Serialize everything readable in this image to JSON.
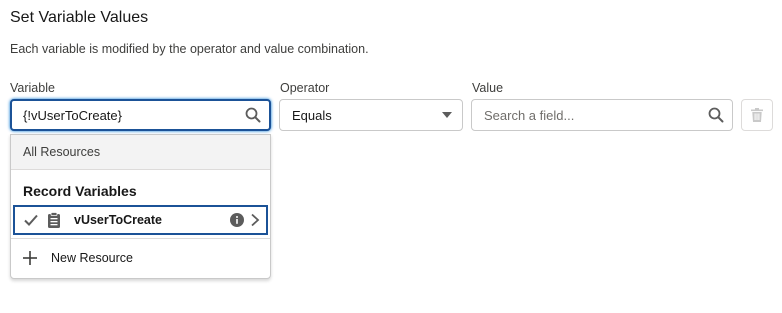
{
  "panel": {
    "title": "Set Variable Values",
    "description": "Each variable is modified by the operator and value combination."
  },
  "fields": {
    "variable_label": "Variable",
    "variable_value": "{!vUserToCreate}",
    "operator_label": "Operator",
    "operator_value": "Equals",
    "value_label": "Value",
    "value_placeholder": "Search a field..."
  },
  "dropdown": {
    "all_resources": "All Resources",
    "group_label": "Record Variables",
    "selected_item": "vUserToCreate",
    "new_resource": "New Resource"
  },
  "icons": {
    "search": "search-icon",
    "caret": "chevron-down-icon",
    "delete": "trash-icon",
    "check": "check-icon",
    "record": "clipboard-icon",
    "info": "info-icon",
    "chevron": "chevron-right-icon",
    "add": "plus-icon"
  },
  "colors": {
    "focus_border": "#1b5297",
    "icon_gray": "#5c5c5c",
    "disabled_gray": "#c9c9c9"
  }
}
